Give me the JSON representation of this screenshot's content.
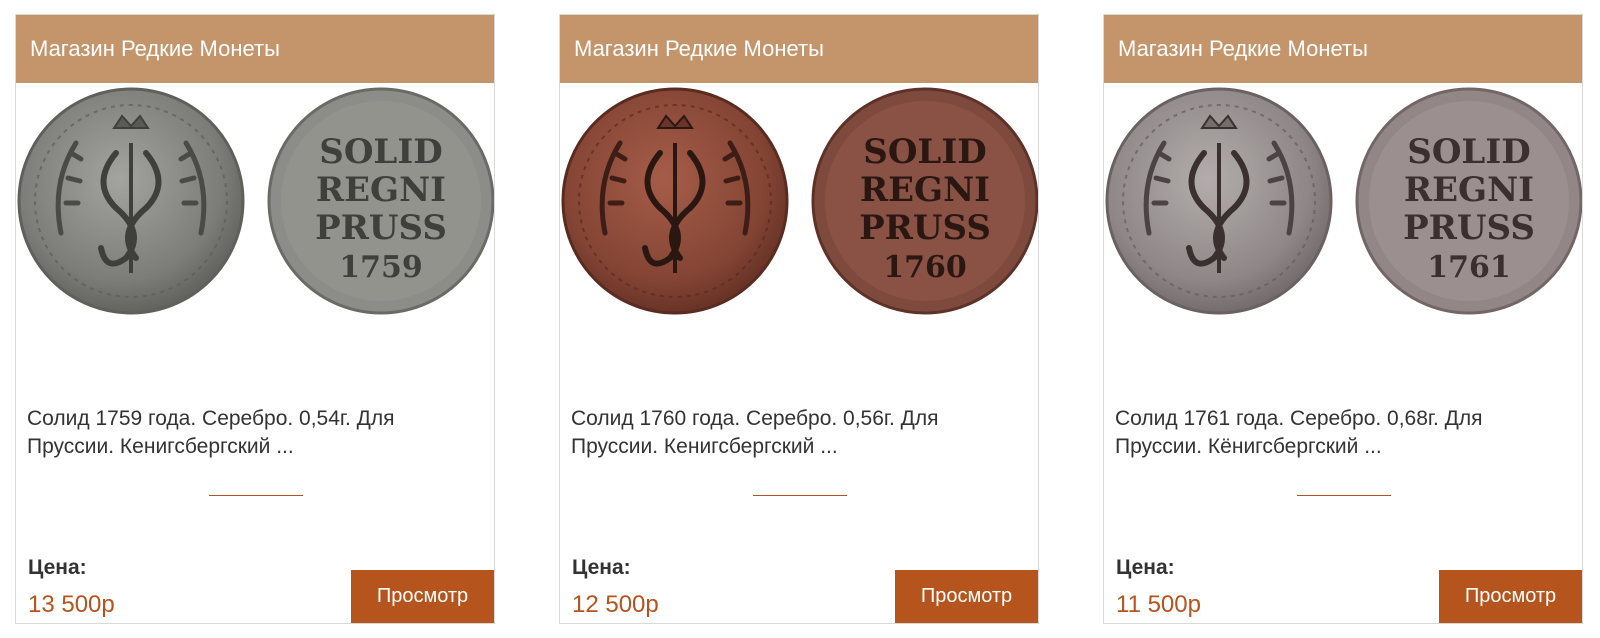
{
  "cards": [
    {
      "shop": "Магазин Редкие Монеты",
      "description": "Солид 1759 года. Серебро. 0,54г. Для Пруссии. Кенигсбергский ...",
      "price_label": "Цена:",
      "price": "13 500р",
      "button": "Просмотр",
      "coin": {
        "metal": "silver",
        "face_color": "#8a8a86",
        "rim_color": "#6e6e6a",
        "text_color": "#3f3f3c",
        "legend": [
          "SOLID",
          "REGNI",
          "PRUSS",
          "1759"
        ]
      }
    },
    {
      "shop": "Магазин Редкие Монеты",
      "description": "Солид 1760 года. Серебро. 0,56г. Для Пруссии. Кенигсбергский ...",
      "price_label": "Цена:",
      "price": "12 500р",
      "button": "Просмотр",
      "coin": {
        "metal": "copper",
        "face_color": "#8a4b3a",
        "rim_color": "#6b3428",
        "text_color": "#2b1712",
        "legend": [
          "SOLID",
          "REGNI",
          "PRUSS",
          "1760"
        ]
      }
    },
    {
      "shop": "Магазин Редкие Монеты",
      "description": "Солид 1761 года. Серебро. 0,68г. Для Пруссии. Кёнигсбергский ...",
      "price_label": "Цена:",
      "price": "11 500р",
      "button": "Просмотр",
      "coin": {
        "metal": "silver-toned",
        "face_color": "#9a8e8e",
        "rim_color": "#7a6e6e",
        "text_color": "#3b3030",
        "legend": [
          "SOLID",
          "REGNI",
          "PRUSS",
          "1761"
        ]
      }
    }
  ],
  "colors": {
    "header_bg": "#c4956a",
    "accent": "#b5541c",
    "text": "#333333"
  }
}
